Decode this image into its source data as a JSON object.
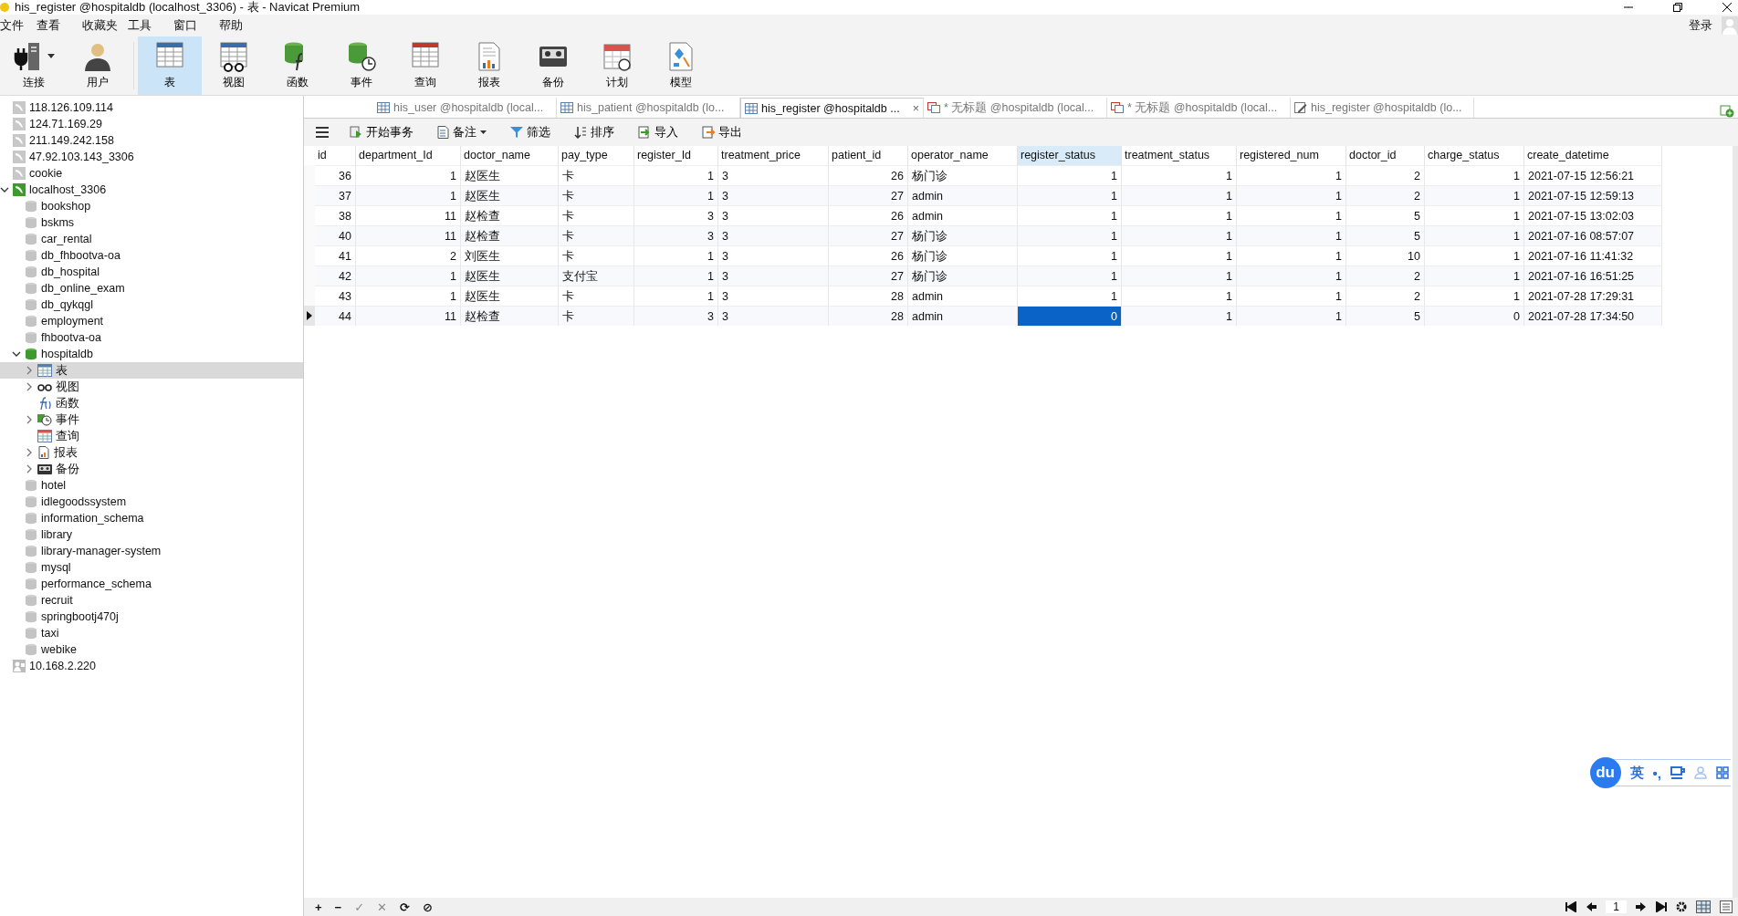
{
  "window": {
    "title": "his_register @hospitaldb (localhost_3306) - 表 - Navicat Premium"
  },
  "menu": [
    "文件",
    "查看",
    "收藏夹",
    "工具",
    "窗口",
    "帮助"
  ],
  "login": "登录",
  "toolbar": [
    {
      "label": "连接",
      "kind": "connection",
      "dropdown": true,
      "selected": false
    },
    {
      "label": "用户",
      "kind": "user",
      "dropdown": false,
      "selected": false
    },
    {
      "label": "表",
      "kind": "table",
      "dropdown": false,
      "selected": true
    },
    {
      "label": "视图",
      "kind": "view",
      "dropdown": false,
      "selected": false
    },
    {
      "label": "函数",
      "kind": "function",
      "dropdown": false,
      "selected": false
    },
    {
      "label": "事件",
      "kind": "event",
      "dropdown": false,
      "selected": false
    },
    {
      "label": "查询",
      "kind": "query",
      "dropdown": false,
      "selected": false
    },
    {
      "label": "报表",
      "kind": "report",
      "dropdown": false,
      "selected": false
    },
    {
      "label": "备份",
      "kind": "backup",
      "dropdown": false,
      "selected": false
    },
    {
      "label": "计划",
      "kind": "schedule",
      "dropdown": false,
      "selected": false
    },
    {
      "label": "模型",
      "kind": "model",
      "dropdown": false,
      "selected": false
    }
  ],
  "sidebar": {
    "items": [
      {
        "label": "118.126.109.114",
        "kind": "connection",
        "connected": false,
        "expanded": false,
        "selected": false
      },
      {
        "label": "124.71.169.29",
        "kind": "connection",
        "connected": false,
        "expanded": false,
        "selected": false
      },
      {
        "label": "211.149.242.158",
        "kind": "connection",
        "connected": false,
        "expanded": false,
        "selected": false
      },
      {
        "label": "47.92.103.143_3306",
        "kind": "connection",
        "connected": false,
        "expanded": false,
        "selected": false
      },
      {
        "label": "cookie",
        "kind": "connection",
        "connected": false,
        "expanded": false,
        "selected": false
      },
      {
        "label": "localhost_3306",
        "kind": "connection",
        "connected": true,
        "expanded": true,
        "selected": false,
        "children": [
          {
            "label": "bookshop",
            "kind": "database",
            "connected": false,
            "expanded": false,
            "selected": false
          },
          {
            "label": "bskms",
            "kind": "database",
            "connected": false,
            "expanded": false,
            "selected": false
          },
          {
            "label": "car_rental",
            "kind": "database",
            "connected": false,
            "expanded": false,
            "selected": false
          },
          {
            "label": "db_fhbootva-oa",
            "kind": "database",
            "connected": false,
            "expanded": false,
            "selected": false
          },
          {
            "label": "db_hospital",
            "kind": "database",
            "connected": false,
            "expanded": false,
            "selected": false
          },
          {
            "label": "db_online_exam",
            "kind": "database",
            "connected": false,
            "expanded": false,
            "selected": false
          },
          {
            "label": "db_qykqgl",
            "kind": "database",
            "connected": false,
            "expanded": false,
            "selected": false
          },
          {
            "label": "employment",
            "kind": "database",
            "connected": false,
            "expanded": false,
            "selected": false
          },
          {
            "label": "fhbootva-oa",
            "kind": "database",
            "connected": false,
            "expanded": false,
            "selected": false
          },
          {
            "label": "hospitaldb",
            "kind": "database",
            "connected": true,
            "expanded": true,
            "selected": false,
            "children": [
              {
                "label": "表",
                "kind": "tables",
                "expandable": true,
                "selected": true
              },
              {
                "label": "视图",
                "kind": "views",
                "expandable": true,
                "selected": false
              },
              {
                "label": "函数",
                "kind": "functions",
                "expandable": false,
                "selected": false
              },
              {
                "label": "事件",
                "kind": "events",
                "expandable": true,
                "selected": false
              },
              {
                "label": "查询",
                "kind": "queries",
                "expandable": false,
                "selected": false
              },
              {
                "label": "报表",
                "kind": "reports",
                "expandable": true,
                "selected": false
              },
              {
                "label": "备份",
                "kind": "backups",
                "expandable": true,
                "selected": false
              }
            ]
          },
          {
            "label": "hotel",
            "kind": "database",
            "connected": false,
            "expanded": false,
            "selected": false
          },
          {
            "label": "idlegoodssystem",
            "kind": "database",
            "connected": false,
            "expanded": false,
            "selected": false
          },
          {
            "label": "information_schema",
            "kind": "database",
            "connected": false,
            "expanded": false,
            "selected": false
          },
          {
            "label": "library",
            "kind": "database",
            "connected": false,
            "expanded": false,
            "selected": false
          },
          {
            "label": "library-manager-system",
            "kind": "database",
            "connected": false,
            "expanded": false,
            "selected": false
          },
          {
            "label": "mysql",
            "kind": "database",
            "connected": false,
            "expanded": false,
            "selected": false
          },
          {
            "label": "performance_schema",
            "kind": "database",
            "connected": false,
            "expanded": false,
            "selected": false
          },
          {
            "label": "recruit",
            "kind": "database",
            "connected": false,
            "expanded": false,
            "selected": false
          },
          {
            "label": "springbootj470j",
            "kind": "database",
            "connected": false,
            "expanded": false,
            "selected": false
          },
          {
            "label": "taxi",
            "kind": "database",
            "connected": false,
            "expanded": false,
            "selected": false
          },
          {
            "label": "webike",
            "kind": "database",
            "connected": false,
            "expanded": false,
            "selected": false
          }
        ]
      },
      {
        "label": "10.168.2.220",
        "kind": "remote",
        "connected": false,
        "expanded": false,
        "selected": false
      }
    ]
  },
  "tabs": [
    {
      "label": "his_user @hospitaldb (local...",
      "kind": "table",
      "selected": false,
      "close": false
    },
    {
      "label": "his_patient @hospitaldb (lo...",
      "kind": "table",
      "selected": false,
      "close": false
    },
    {
      "label": "his_register @hospitaldb ...",
      "kind": "table",
      "selected": true,
      "close": true
    },
    {
      "label": "* 无标题 @hospitaldb (local...",
      "kind": "query",
      "selected": false,
      "close": false
    },
    {
      "label": "* 无标题 @hospitaldb (local...",
      "kind": "query",
      "selected": false,
      "close": false
    },
    {
      "label": "his_register @hospitaldb (lo...",
      "kind": "design",
      "selected": false,
      "close": false
    }
  ],
  "close_symbol": "×",
  "actions": [
    {
      "label": "开始事务",
      "kind": "transaction",
      "dropdown": false
    },
    {
      "label": "备注",
      "kind": "memo",
      "dropdown": true
    },
    {
      "label": "筛选",
      "kind": "filter",
      "dropdown": false
    },
    {
      "label": "排序",
      "kind": "sort",
      "dropdown": false
    },
    {
      "label": "导入",
      "kind": "import",
      "dropdown": false
    },
    {
      "label": "导出",
      "kind": "export",
      "dropdown": false
    }
  ],
  "table": {
    "columns": [
      {
        "name": "id",
        "selected": false
      },
      {
        "name": "department_Id",
        "selected": false
      },
      {
        "name": "doctor_name",
        "selected": false
      },
      {
        "name": "pay_type",
        "selected": false
      },
      {
        "name": "register_Id",
        "selected": false
      },
      {
        "name": "treatment_price",
        "selected": false
      },
      {
        "name": "patient_id",
        "selected": false
      },
      {
        "name": "operator_name",
        "selected": false
      },
      {
        "name": "register_status",
        "selected": true
      },
      {
        "name": "treatment_status",
        "selected": false
      },
      {
        "name": "registered_num",
        "selected": false
      },
      {
        "name": "doctor_id",
        "selected": false
      },
      {
        "name": "charge_status",
        "selected": false
      },
      {
        "name": "create_datetime",
        "selected": false
      }
    ],
    "rows": [
      {
        "current": false,
        "cells": [
          "36",
          "1",
          "赵医生",
          "卡",
          "1",
          "3",
          "26",
          "杨门诊",
          "1",
          "1",
          "1",
          "2",
          "1",
          "2021-07-15 12:56:21"
        ]
      },
      {
        "current": false,
        "cells": [
          "37",
          "1",
          "赵医生",
          "卡",
          "1",
          "3",
          "27",
          "admin",
          "1",
          "1",
          "1",
          "2",
          "1",
          "2021-07-15 12:59:13"
        ]
      },
      {
        "current": false,
        "cells": [
          "38",
          "11",
          "赵检查",
          "卡",
          "3",
          "3",
          "26",
          "admin",
          "1",
          "1",
          "1",
          "5",
          "1",
          "2021-07-15 13:02:03"
        ]
      },
      {
        "current": false,
        "cells": [
          "40",
          "11",
          "赵检查",
          "卡",
          "3",
          "3",
          "27",
          "杨门诊",
          "1",
          "1",
          "1",
          "5",
          "1",
          "2021-07-16 08:57:07"
        ]
      },
      {
        "current": false,
        "cells": [
          "41",
          "2",
          "刘医生",
          "卡",
          "1",
          "3",
          "26",
          "杨门诊",
          "1",
          "1",
          "1",
          "10",
          "1",
          "2021-07-16 11:41:32"
        ]
      },
      {
        "current": false,
        "cells": [
          "42",
          "1",
          "赵医生",
          "支付宝",
          "1",
          "3",
          "27",
          "杨门诊",
          "1",
          "1",
          "1",
          "2",
          "1",
          "2021-07-16 16:51:25"
        ]
      },
      {
        "current": false,
        "cells": [
          "43",
          "1",
          "赵医生",
          "卡",
          "1",
          "3",
          "28",
          "admin",
          "1",
          "1",
          "1",
          "2",
          "1",
          "2021-07-28 17:29:31"
        ]
      },
      {
        "current": true,
        "cells": [
          "44",
          "11",
          "赵检查",
          "卡",
          "3",
          "3",
          "28",
          "admin",
          "0",
          "1",
          "1",
          "5",
          "0",
          "2021-07-28 17:34:50"
        ]
      }
    ]
  },
  "bottom_buttons": [
    {
      "symbol": "+",
      "disabled": false
    },
    {
      "symbol": "−",
      "disabled": false
    },
    {
      "symbol": "✓",
      "disabled": true
    },
    {
      "symbol": "✕",
      "disabled": true
    },
    {
      "symbol": "⟳",
      "disabled": false
    },
    {
      "symbol": "⊘",
      "disabled": false
    }
  ],
  "page": "1",
  "ime": {
    "logo": "du",
    "mode": "英",
    "punct": "•,"
  }
}
